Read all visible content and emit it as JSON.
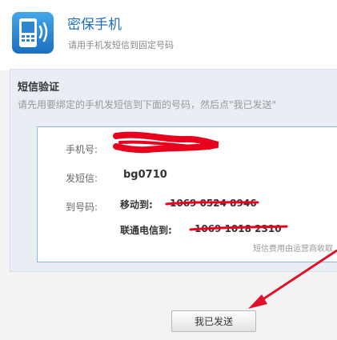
{
  "header": {
    "icon": "mobile-phone-icon",
    "title": "密保手机",
    "subtitle": "请用手机发短信到固定号码"
  },
  "sms": {
    "title": "短信验证",
    "instruction": "请先用要绑定的手机发短信到下面的号码，然后点\"我已发送\"",
    "phone_label": "手机号:",
    "phone_value": "",
    "send_label": "发短信:",
    "send_value": "bg0710",
    "to_label": "到号码:",
    "mobile_label": "移动到:",
    "mobile_number": "1069 0524 8946",
    "unicom_label": "联通电信到:",
    "unicom_number": "1069 1018 2310",
    "fee_note": "短信费用由运营商收取"
  },
  "button": {
    "label": "我已发送"
  },
  "colors": {
    "accent": "#1f6fb8",
    "redaction": "#e8001c",
    "arrow": "#e0102a"
  }
}
